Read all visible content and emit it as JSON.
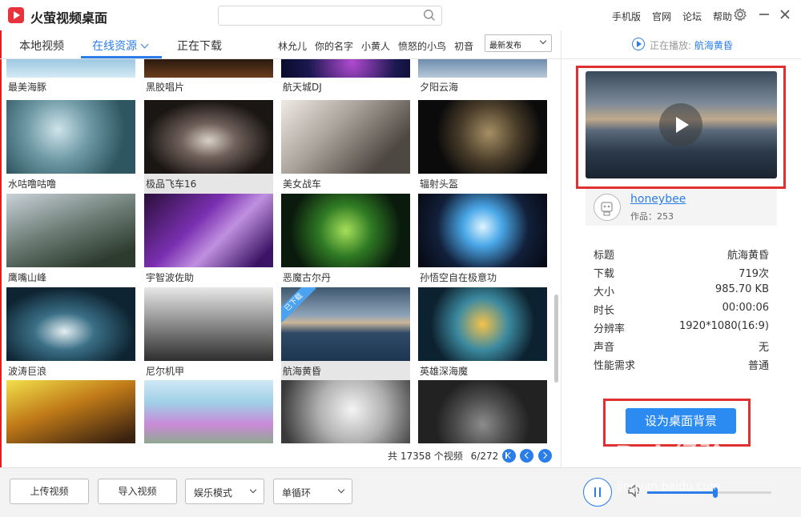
{
  "app": {
    "title": "火萤视频桌面"
  },
  "search": {
    "placeholder": ""
  },
  "top_links": [
    "手机版",
    "官网",
    "论坛",
    "帮助"
  ],
  "tabs": [
    {
      "label": "本地视频"
    },
    {
      "label": "在线资源"
    },
    {
      "label": "正在下载"
    }
  ],
  "tags": [
    "林允儿",
    "你的名字",
    "小黄人",
    "愤怒的小鸟",
    "初音"
  ],
  "sort": {
    "selected": "最新发布"
  },
  "videos": [
    {
      "title": "最美海豚"
    },
    {
      "title": "黑胶唱片"
    },
    {
      "title": "航天城DJ"
    },
    {
      "title": "夕阳云海"
    },
    {
      "title": "水咕噜咕噜"
    },
    {
      "title": "极品飞车16"
    },
    {
      "title": "美女战车"
    },
    {
      "title": "辐射头盔"
    },
    {
      "title": "鹰嘴山峰"
    },
    {
      "title": "宇智波佐助"
    },
    {
      "title": "恶魔古尔丹"
    },
    {
      "title": "孙悟空自在极意功"
    },
    {
      "title": "波涛巨浪"
    },
    {
      "title": "尼尔机甲"
    },
    {
      "title": "航海黄昏",
      "badge": "已下载"
    },
    {
      "title": "英雄深海魔"
    },
    {
      "title": ""
    },
    {
      "title": ""
    },
    {
      "title": ""
    },
    {
      "title": ""
    }
  ],
  "pagination": {
    "total_text": "共 17358 个视频",
    "page_text": "6/272"
  },
  "now_playing": {
    "prefix": "正在播放:",
    "title": "航海黄昏"
  },
  "author": {
    "name": "honeybee",
    "works": "作品：253"
  },
  "info": [
    {
      "k": "标题",
      "v": "航海黄昏"
    },
    {
      "k": "下载",
      "v": "719次"
    },
    {
      "k": "大小",
      "v": "985.70 KB"
    },
    {
      "k": "时长",
      "v": "00:00:06"
    },
    {
      "k": "分辨率",
      "v": "1920*1080(16:9)"
    },
    {
      "k": "声音",
      "v": "无"
    },
    {
      "k": "性能需求",
      "v": "普通"
    }
  ],
  "set_bg_label": "设为桌面背景",
  "bottom": {
    "upload": "上传视频",
    "import": "导入视频",
    "mode": "娱乐模式",
    "loop": "单循环"
  },
  "volume": {
    "level": 0.55
  },
  "watermark": {
    "brand": "Bai 经验",
    "url": "jingyan.baidu.com"
  },
  "icons": [
    "logo-icon",
    "search-icon",
    "gear-icon",
    "minimize-icon",
    "close-icon",
    "chevron-down-icon",
    "play-icon",
    "pause-icon",
    "volume-icon",
    "avatar-icon"
  ],
  "colors": {
    "accent": "#2b7de9",
    "highlight": "#e03030",
    "brand": "#e8323c"
  }
}
